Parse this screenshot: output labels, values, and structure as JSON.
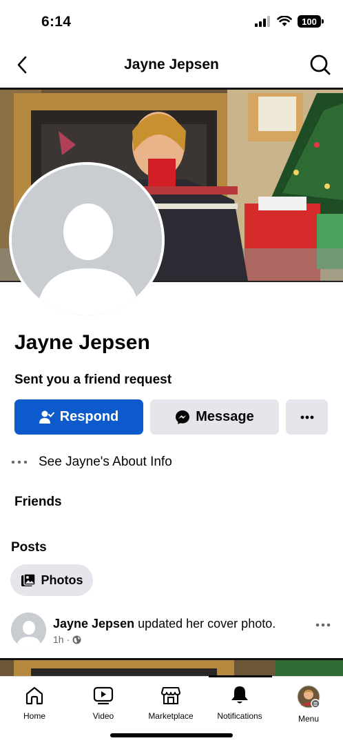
{
  "status": {
    "time": "6:14",
    "battery": "100"
  },
  "nav": {
    "title": "Jayne Jepsen"
  },
  "profile": {
    "name": "Jayne Jepsen",
    "request_text": "Sent you a friend request",
    "respond_label": "Respond",
    "message_label": "Message",
    "about_label": "See Jayne's About Info"
  },
  "sections": {
    "friends": "Friends",
    "posts": "Posts"
  },
  "filter": {
    "photos_label": "Photos"
  },
  "post": {
    "author": "Jayne Jepsen",
    "action": " updated her cover photo.",
    "time": "1h",
    "separator": "·"
  },
  "tabs": [
    {
      "label": "Home",
      "icon": "home-icon"
    },
    {
      "label": "Video",
      "icon": "video-icon"
    },
    {
      "label": "Marketplace",
      "icon": "marketplace-icon"
    },
    {
      "label": "Notifications",
      "icon": "bell-icon",
      "active": true
    },
    {
      "label": "Menu",
      "icon": "profile-avatar-icon"
    }
  ],
  "colors": {
    "primary": "#0c5acb",
    "secondary_button": "#e4e6eb",
    "text": "#050505",
    "muted": "#65676b"
  }
}
